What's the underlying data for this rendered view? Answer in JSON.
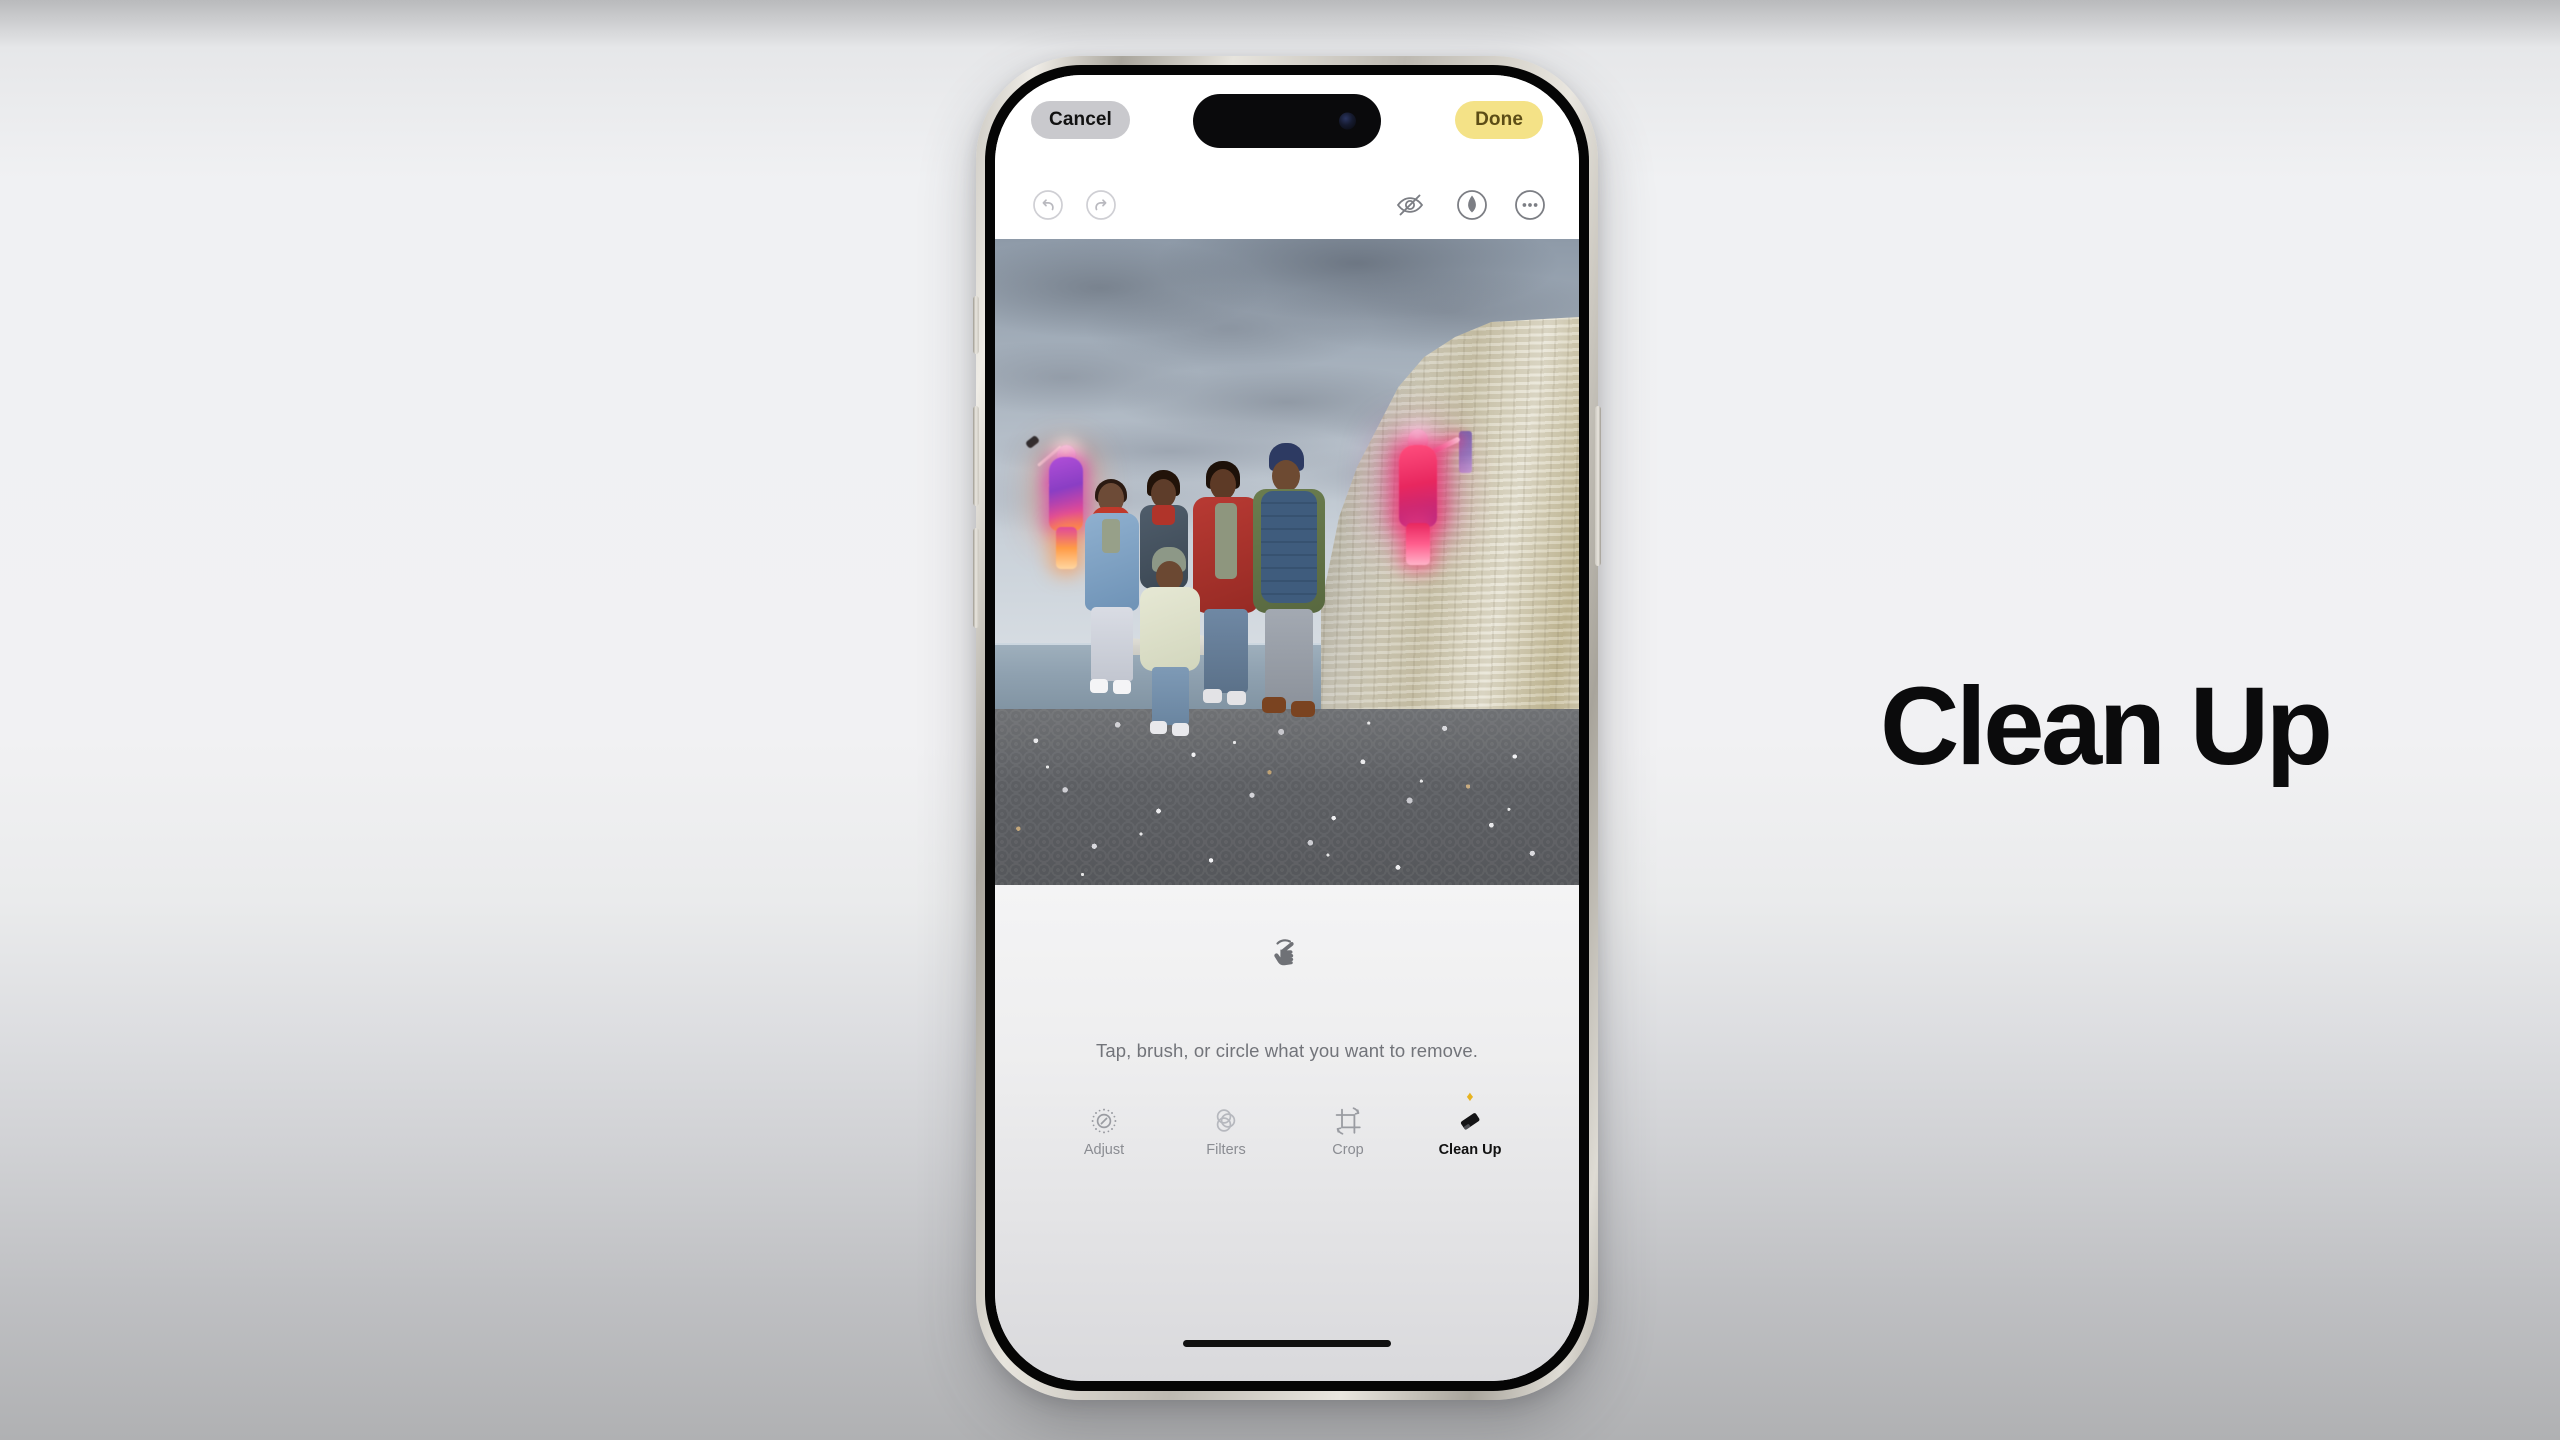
{
  "headline": "Clean Up",
  "phone": {
    "device": "iphone-16-pro",
    "nav": {
      "cancel_label": "Cancel",
      "done_label": "Done",
      "cancel_bg": "#c9c9cd",
      "done_bg": "#f4e287",
      "done_text_color": "#5c4d16"
    },
    "tools": {
      "undo": "undo-icon",
      "redo": "redo-icon",
      "hide_markup": "eye-slash-icon",
      "markup": "markup-pen-icon",
      "more": "more-ellipsis-icon"
    },
    "photo": {
      "description": "Family of five on a pebble beach below white chalk cliffs under an overcast sky",
      "highlighted_subjects": [
        {
          "name": "person-with-selfie-stick",
          "position": "left",
          "glow_colors": [
            "#b04fd8",
            "#e0489a",
            "#ff8a3d"
          ]
        },
        {
          "name": "person-with-flag",
          "position": "right",
          "glow_colors": [
            "#ff4e7e",
            "#e8275f",
            "#b02a86"
          ]
        }
      ]
    },
    "cleanup": {
      "gesture_icon": "tap-hand-icon",
      "hint": "Tap, brush, or circle what you want to remove."
    },
    "tabs": [
      {
        "label": "Adjust",
        "icon": "adjust-dial-icon",
        "active": false,
        "badge": ""
      },
      {
        "label": "Filters",
        "icon": "filters-circles-icon",
        "active": false,
        "badge": ""
      },
      {
        "label": "Crop",
        "icon": "crop-rotate-icon",
        "active": false,
        "badge": ""
      },
      {
        "label": "Clean Up",
        "icon": "eraser-icon",
        "active": true,
        "badge": "♦"
      }
    ]
  }
}
